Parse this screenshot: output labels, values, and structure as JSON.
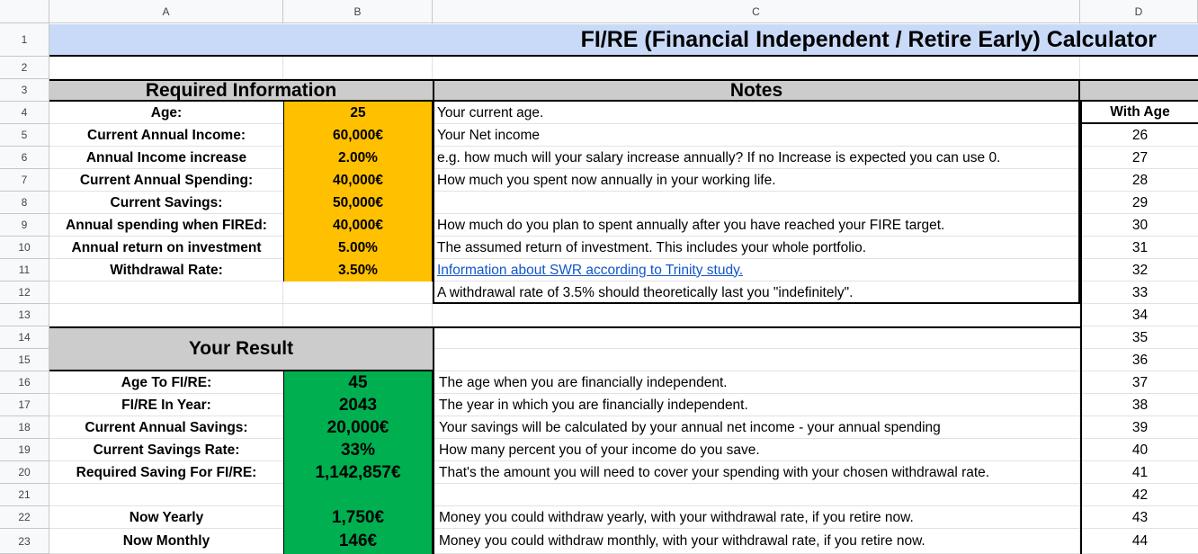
{
  "columns": [
    "A",
    "B",
    "C",
    "D"
  ],
  "rows": [
    "1",
    "2",
    "3",
    "4",
    "5",
    "6",
    "7",
    "8",
    "9",
    "10",
    "11",
    "12",
    "13",
    "14",
    "15",
    "16",
    "17",
    "18",
    "19",
    "20",
    "21",
    "22",
    "23"
  ],
  "title": "FI/RE (Financial Independent / Retire Early) Calculator",
  "required": {
    "header": "Required Information",
    "items": [
      {
        "label": "Age:",
        "value": "25"
      },
      {
        "label": "Current Annual Income:",
        "value": "60,000€"
      },
      {
        "label": "Annual Income increase",
        "value": "2.00%"
      },
      {
        "label": "Current Annual Spending:",
        "value": "40,000€"
      },
      {
        "label": "Current Savings:",
        "value": "50,000€"
      },
      {
        "label": "Annual spending when FIREd:",
        "value": "40,000€"
      },
      {
        "label": "Annual return on investment",
        "value": "5.00%"
      },
      {
        "label": "Withdrawal Rate:",
        "value": "3.50%"
      }
    ]
  },
  "notes": {
    "header": "Notes",
    "required_notes": [
      "Your current age.",
      "Your Net income",
      "e.g. how much will your salary increase annually? If no Increase is expected you can use 0.",
      "How much you spent now annually in your working life.",
      "",
      "How much do you plan to spent annually after you have reached your FIRE target.",
      "The assumed return of investment. This includes your whole portfolio.",
      "Information about SWR according to Trinity study.",
      "A withdrawal rate of 3.5% should theoretically last you \"indefinitely\"."
    ],
    "result_notes": [
      "The age when you are financially independent.",
      "The year in which you are financially independent.",
      "Your savings will be calculated by your annual net income - your annual spending",
      "How many percent you of your income do you save.",
      "That's the amount you will need to cover your spending with your chosen withdrawal rate.",
      "",
      "Money you could withdraw yearly, with your withdrawal rate, if you retire now.",
      "Money you could withdraw monthly, with your withdrawal rate, if you retire now."
    ]
  },
  "result": {
    "header": "Your Result",
    "items": [
      {
        "label": "Age To FI/RE:",
        "value": "45"
      },
      {
        "label": "FI/RE In Year:",
        "value": "2043"
      },
      {
        "label": "Current Annual Savings:",
        "value": "20,000€"
      },
      {
        "label": "Current Savings Rate:",
        "value": "33%"
      },
      {
        "label": "Required Saving For FI/RE:",
        "value": "1,142,857€"
      },
      {
        "label": "",
        "value": ""
      },
      {
        "label": "Now Yearly",
        "value": "1,750€"
      },
      {
        "label": "Now Monthly",
        "value": "146€"
      }
    ]
  },
  "age_column": {
    "header": "With Age",
    "values": [
      "26",
      "27",
      "28",
      "29",
      "30",
      "31",
      "32",
      "33",
      "34",
      "35",
      "36",
      "37",
      "38",
      "39",
      "40",
      "41",
      "42",
      "43",
      "44"
    ]
  },
  "colors": {
    "title_bg": "#c9daf8",
    "header_bg": "#cccccc",
    "input_bg": "#ffc000",
    "result_bg": "#00b050",
    "link": "#1155cc"
  }
}
